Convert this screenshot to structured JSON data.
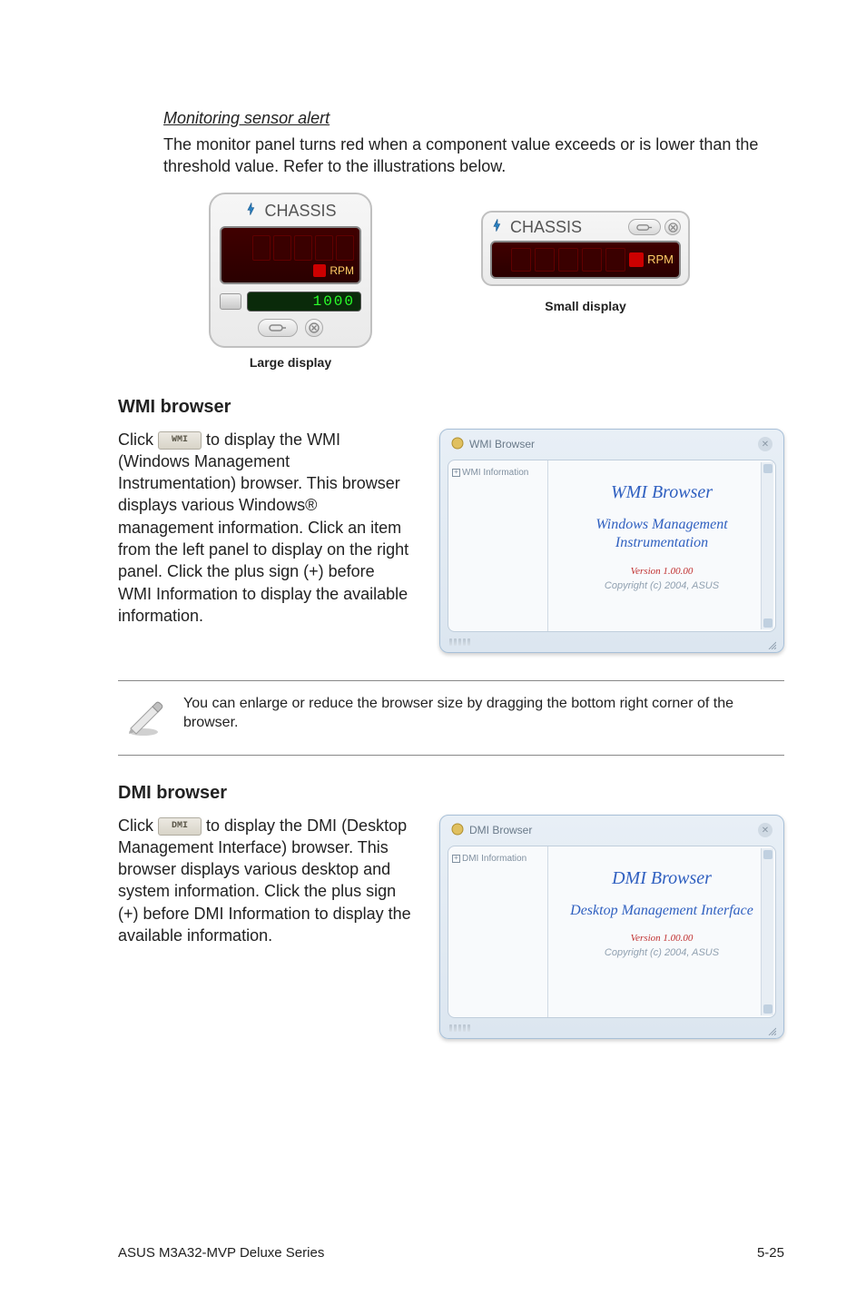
{
  "alert": {
    "subhead": "Monitoring sensor alert",
    "body": "The monitor panel turns red when a component value exceeds or is lower than the threshold value. Refer to the illustrations below.",
    "large": {
      "title": "CHASSIS",
      "unit": "RPM",
      "threshold": "1000",
      "caption": "Large display"
    },
    "small": {
      "title": "CHASSIS",
      "unit": "RPM",
      "caption": "Small display"
    }
  },
  "wmi": {
    "title": "WMI browser",
    "btn": "WMI",
    "body1": "Click ",
    "body2": " to display the WMI (Windows Management Instrumentation) browser. This browser displays various Windows® management information. Click an item from the left panel to display on the right panel. Click the plus sign (+) before WMI Information to display the available information.",
    "win": {
      "titlebar": "WMI Browser",
      "tree": "WMI Information",
      "heading": "WMI Browser",
      "sub": "Windows Management Instrumentation",
      "version": "Version 1.00.00",
      "copyright": "Copyright (c) 2004, ASUS"
    }
  },
  "note": {
    "text": "You can enlarge or reduce the browser size by dragging the bottom right corner of the browser."
  },
  "dmi": {
    "title": "DMI browser",
    "btn": "DMI",
    "body1": "Click ",
    "body2": " to display the DMI (Desktop Management Interface) browser. This browser displays various desktop and system information. Click the plus sign (+) before DMI Information to display the available information.",
    "win": {
      "titlebar": "DMI Browser",
      "tree": "DMI Information",
      "heading": "DMI Browser",
      "sub": "Desktop Management Interface",
      "version": "Version 1.00.00",
      "copyright": "Copyright (c) 2004, ASUS"
    }
  },
  "footer": {
    "left": "ASUS M3A32-MVP Deluxe Series",
    "right": "5-25"
  }
}
